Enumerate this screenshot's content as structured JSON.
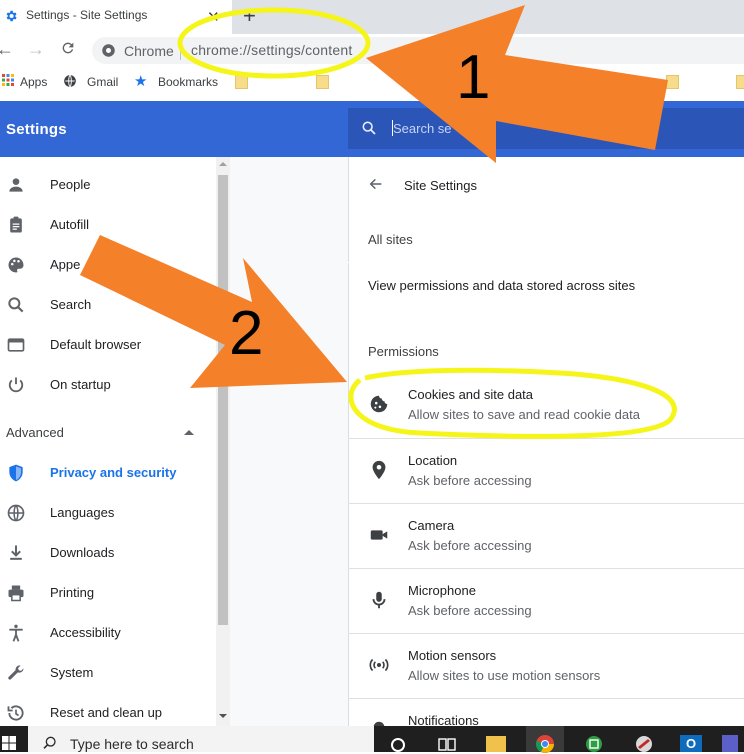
{
  "browser": {
    "tab_title": "Settings - Site Settings",
    "chip_label": "Chrome",
    "url": "chrome://settings/content",
    "bookmarks": [
      "Apps",
      "Gmail",
      "Bookmarks"
    ]
  },
  "header": {
    "title": "Settings",
    "search_placeholder": "Search se"
  },
  "sidebar": {
    "items": [
      {
        "label": "People",
        "icon": "person-icon"
      },
      {
        "label": "Autofill",
        "icon": "clipboard-icon"
      },
      {
        "label": "Appe",
        "icon": "palette-icon"
      },
      {
        "label": "Search",
        "icon": "search-icon"
      },
      {
        "label": "Default browser",
        "icon": "browser-window-icon"
      },
      {
        "label": "On startup",
        "icon": "power-icon"
      }
    ],
    "advanced_label": "Advanced",
    "advanced_items": [
      {
        "label": "Privacy and security",
        "icon": "shield-icon",
        "active": true
      },
      {
        "label": "Languages",
        "icon": "globe-icon"
      },
      {
        "label": "Downloads",
        "icon": "download-icon"
      },
      {
        "label": "Printing",
        "icon": "printer-icon"
      },
      {
        "label": "Accessibility",
        "icon": "accessibility-icon"
      },
      {
        "label": "System",
        "icon": "wrench-icon"
      },
      {
        "label": "Reset and clean up",
        "icon": "history-icon"
      }
    ]
  },
  "content": {
    "page_title": "Site Settings",
    "all_sites": "All sites",
    "view_permissions": "View permissions and data stored across sites",
    "permissions_header": "Permissions",
    "permissions": [
      {
        "title": "Cookies and site data",
        "subtitle": "Allow sites to save and read cookie data",
        "icon": "cookie-icon"
      },
      {
        "title": "Location",
        "subtitle": "Ask before accessing",
        "icon": "location-pin-icon"
      },
      {
        "title": "Camera",
        "subtitle": "Ask before accessing",
        "icon": "camera-icon"
      },
      {
        "title": "Microphone",
        "subtitle": "Ask before accessing",
        "icon": "microphone-icon"
      },
      {
        "title": "Motion sensors",
        "subtitle": "Allow sites to use motion sensors",
        "icon": "motion-sensor-icon"
      },
      {
        "title": "Notifications",
        "subtitle": "",
        "icon": "bell-icon"
      }
    ]
  },
  "taskbar": {
    "search_placeholder": "Type here to search"
  },
  "annotations": {
    "step1": "1",
    "step2": "2",
    "highlight_color": "#f5f51a",
    "arrow_color": "#f5802a"
  },
  "colors": {
    "header_blue": "#3367d6",
    "active_blue": "#1a73e8"
  }
}
